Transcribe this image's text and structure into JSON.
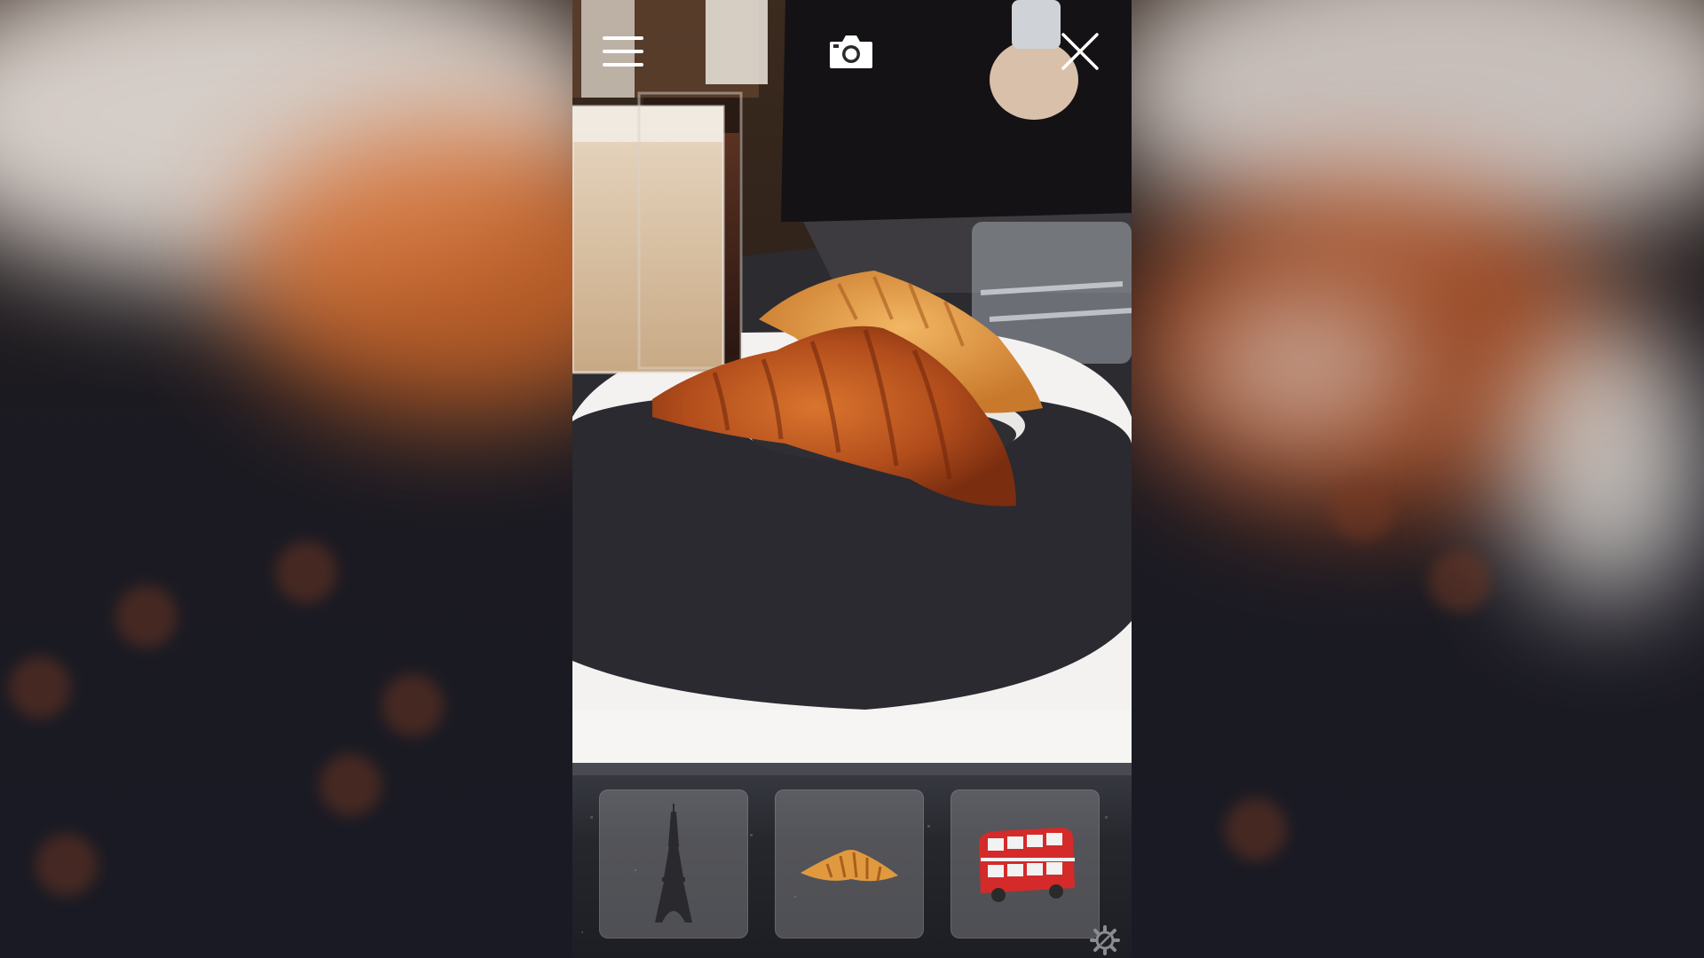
{
  "app": {
    "accent_color": "#ffffff",
    "tray_item_bg": "#9a9aa0"
  },
  "top_bar": {
    "menu_icon": "hamburger-menu-icon",
    "camera_icon": "camera-icon",
    "close_icon": "close-icon"
  },
  "ar_view": {
    "placed_object": "croissant-3d-model"
  },
  "tray": {
    "items": [
      {
        "icon": "eiffel-tower-icon",
        "selected": false
      },
      {
        "icon": "croissant-icon",
        "selected": true
      },
      {
        "icon": "double-decker-bus-icon",
        "selected": false
      }
    ],
    "settings_icon": "gear-icon"
  }
}
